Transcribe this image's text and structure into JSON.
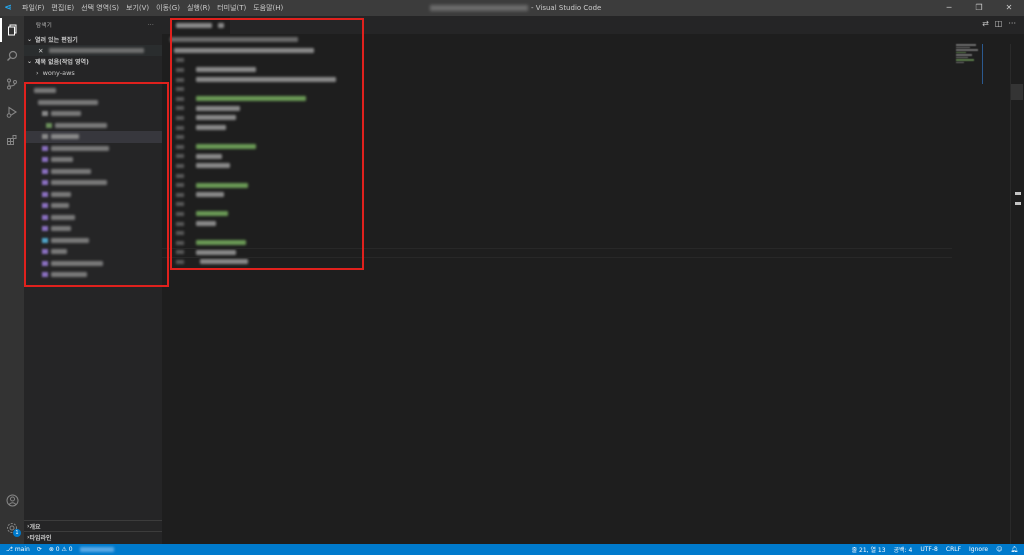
{
  "titlebar": {
    "menu": [
      "파일(F)",
      "편집(E)",
      "선택 영역(S)",
      "보기(V)",
      "이동(G)",
      "실행(R)",
      "터미널(T)",
      "도움말(H)"
    ],
    "app_name": "- Visual Studio Code",
    "controls": [
      "─",
      "❐",
      "✕"
    ]
  },
  "activity_bar": {
    "items": [
      "explorer-icon",
      "search-icon",
      "source-control-icon",
      "run-debug-icon",
      "extensions-icon"
    ],
    "bottom": [
      "account-icon",
      "manage-gear-icon"
    ],
    "gear_badge": "1"
  },
  "sidebar": {
    "title": "탐색기",
    "more": "···",
    "open_editors_label": "열려 있는 편집기",
    "workspace_label": "제목 없음(작업 영역)",
    "folder_name": "wony-aws",
    "outline_label": "개요",
    "timeline_label": "타임라인"
  },
  "statusbar": {
    "branch": "main",
    "problems": "⊗ 0 ⚠ 0",
    "position": "줄 21, 열 13",
    "spaces": "공백: 4",
    "encoding": "UTF-8",
    "eol": "CRLF",
    "language": "Ignore"
  },
  "colors": {
    "accent": "#007acc",
    "highlight_box": "#e0211d",
    "comment_green": "#6a9955"
  }
}
